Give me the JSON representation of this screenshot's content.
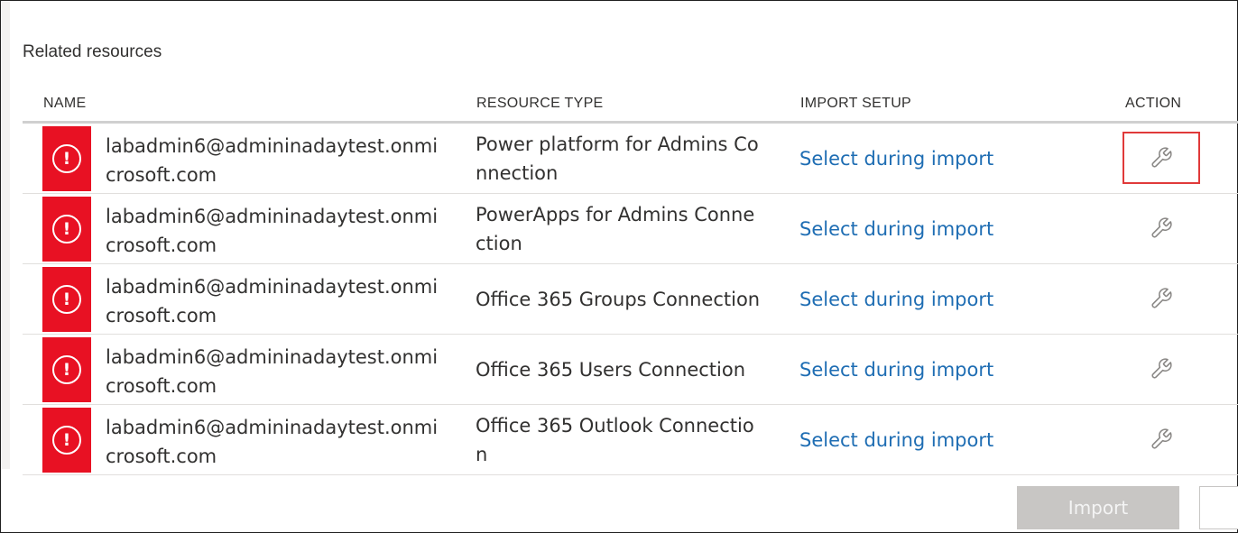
{
  "section": {
    "title": "Related resources"
  },
  "table": {
    "headers": {
      "name": "NAME",
      "resource_type": "RESOURCE TYPE",
      "import_setup": "IMPORT SETUP",
      "action": "ACTION"
    },
    "rows": [
      {
        "name": "labadmin6@admininadaytest.onmicrosoft.com",
        "resource_type": "Power platform for Admins Connection",
        "import_setup": "Select during import",
        "action_icon": "wrench-icon",
        "status_icon": "error-icon"
      },
      {
        "name": "labadmin6@admininadaytest.onmicrosoft.com",
        "resource_type": "PowerApps for Admins Connection",
        "import_setup": "Select during import",
        "action_icon": "wrench-icon",
        "status_icon": "error-icon"
      },
      {
        "name": "labadmin6@admininadaytest.onmicrosoft.com",
        "resource_type": "Office 365 Groups Connection",
        "import_setup": "Select during import",
        "action_icon": "wrench-icon",
        "status_icon": "error-icon"
      },
      {
        "name": "labadmin6@admininadaytest.onmicrosoft.com",
        "resource_type": "Office 365 Users Connection",
        "import_setup": "Select during import",
        "action_icon": "wrench-icon",
        "status_icon": "error-icon"
      },
      {
        "name": "labadmin6@admininadaytest.onmicrosoft.com",
        "resource_type": "Office 365 Outlook Connection",
        "import_setup": "Select during import",
        "action_icon": "wrench-icon",
        "status_icon": "error-icon"
      }
    ]
  },
  "footer": {
    "import_label": "Import"
  },
  "colors": {
    "error": "#e81123",
    "link": "#1e6db3",
    "highlight": "#e03a3a",
    "disabled_button": "#c8c6c4"
  }
}
